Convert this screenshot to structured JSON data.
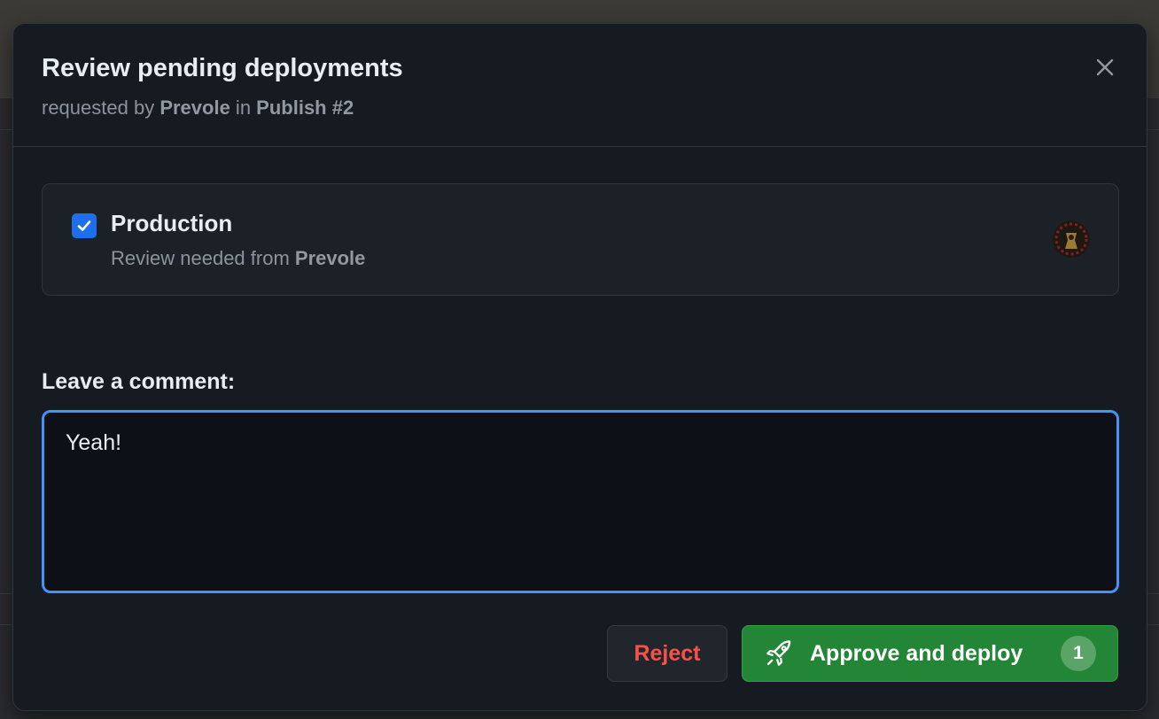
{
  "modal": {
    "title": "Review pending deployments",
    "subtitle": {
      "prefix": "requested by ",
      "user": "Prevole",
      "middle": " in ",
      "workflow": "Publish #2"
    },
    "close_icon": "close-icon"
  },
  "environment": {
    "checked": true,
    "name": "Production",
    "review_prefix": "Review needed from ",
    "reviewer": "Prevole",
    "avatar_icon": "avatar"
  },
  "comment": {
    "label": "Leave a comment:",
    "value": "Yeah!"
  },
  "actions": {
    "reject_label": "Reject",
    "approve_label": "Approve and deploy",
    "approve_icon": "rocket-icon",
    "approve_count": "1"
  },
  "colors": {
    "accent": "#1f6feb",
    "focus": "#4493f8",
    "approve": "#238636",
    "danger": "#f85149",
    "modal_bg": "#161b22"
  }
}
